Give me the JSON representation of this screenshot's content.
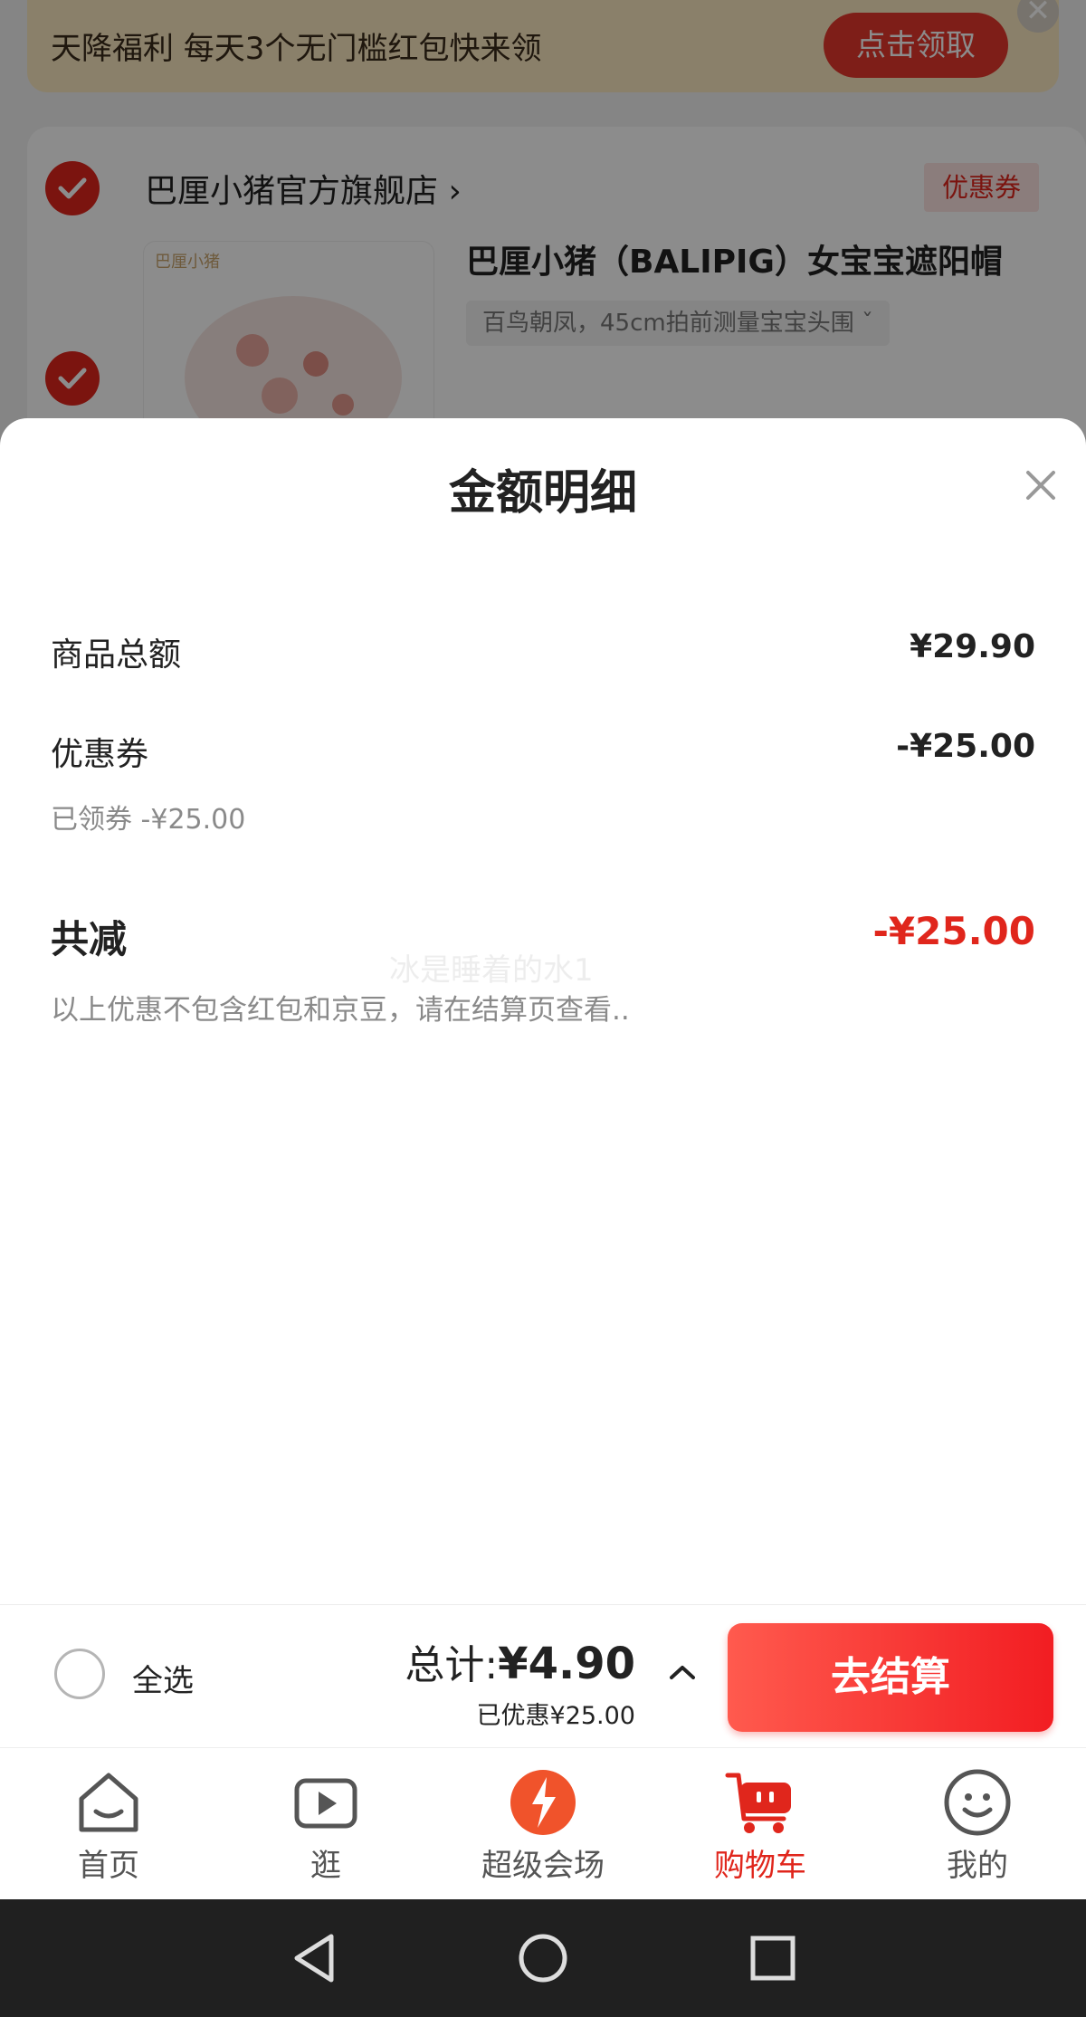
{
  "banner": {
    "text": "天降福利 每天3个无门槛红包快来领",
    "button": "点击领取",
    "close": "✕"
  },
  "shop": {
    "name": "巴厘小猪官方旗舰店 ›",
    "coupon_tag": "优惠券",
    "brand_label": "巴厘小猪",
    "product_title": "巴厘小猪（BALIPIG）女宝宝遮阳帽",
    "spec": "百鸟朝凤，45cm拍前测量宝宝头围  ˇ"
  },
  "sheet": {
    "title": "金额明细",
    "rows": {
      "goods_total": {
        "label": "商品总额",
        "value": "¥29.90"
      },
      "coupon": {
        "label": "优惠券",
        "value": "-¥25.00",
        "sub": "已领券 -¥25.00"
      }
    },
    "total_reduction": {
      "label": "共减",
      "value": "-¥25.00",
      "note": "以上优惠不包含红包和京豆，请在结算页查看.."
    },
    "watermark": "冰是睡着的水1"
  },
  "checkout": {
    "select_all": "全选",
    "total_prefix": "总计:",
    "total_amount": "¥4.90",
    "saved": "已优惠¥25.00",
    "button": "去结算"
  },
  "tabs": [
    {
      "label": "首页",
      "icon": "home-icon"
    },
    {
      "label": "逛",
      "icon": "video-play-icon"
    },
    {
      "label": "超级会场",
      "icon": "super-venue-icon"
    },
    {
      "label": "购物车",
      "icon": "shopping-cart-icon",
      "active": true
    },
    {
      "label": "我的",
      "icon": "smiley-profile-icon"
    }
  ],
  "colors": {
    "accent": "#e0261c",
    "banner_bg": "#fbe9c2"
  }
}
